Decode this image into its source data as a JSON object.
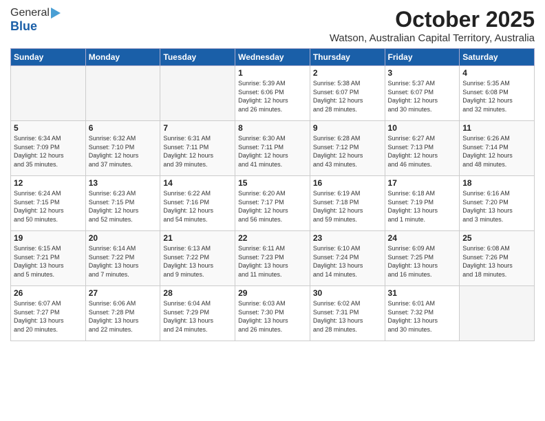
{
  "header": {
    "logo_general": "General",
    "logo_blue": "Blue",
    "month": "October 2025",
    "location": "Watson, Australian Capital Territory, Australia"
  },
  "weekdays": [
    "Sunday",
    "Monday",
    "Tuesday",
    "Wednesday",
    "Thursday",
    "Friday",
    "Saturday"
  ],
  "weeks": [
    [
      {
        "day": "",
        "info": ""
      },
      {
        "day": "",
        "info": ""
      },
      {
        "day": "",
        "info": ""
      },
      {
        "day": "1",
        "info": "Sunrise: 5:39 AM\nSunset: 6:06 PM\nDaylight: 12 hours\nand 26 minutes."
      },
      {
        "day": "2",
        "info": "Sunrise: 5:38 AM\nSunset: 6:07 PM\nDaylight: 12 hours\nand 28 minutes."
      },
      {
        "day": "3",
        "info": "Sunrise: 5:37 AM\nSunset: 6:07 PM\nDaylight: 12 hours\nand 30 minutes."
      },
      {
        "day": "4",
        "info": "Sunrise: 5:35 AM\nSunset: 6:08 PM\nDaylight: 12 hours\nand 32 minutes."
      }
    ],
    [
      {
        "day": "5",
        "info": "Sunrise: 6:34 AM\nSunset: 7:09 PM\nDaylight: 12 hours\nand 35 minutes."
      },
      {
        "day": "6",
        "info": "Sunrise: 6:32 AM\nSunset: 7:10 PM\nDaylight: 12 hours\nand 37 minutes."
      },
      {
        "day": "7",
        "info": "Sunrise: 6:31 AM\nSunset: 7:11 PM\nDaylight: 12 hours\nand 39 minutes."
      },
      {
        "day": "8",
        "info": "Sunrise: 6:30 AM\nSunset: 7:11 PM\nDaylight: 12 hours\nand 41 minutes."
      },
      {
        "day": "9",
        "info": "Sunrise: 6:28 AM\nSunset: 7:12 PM\nDaylight: 12 hours\nand 43 minutes."
      },
      {
        "day": "10",
        "info": "Sunrise: 6:27 AM\nSunset: 7:13 PM\nDaylight: 12 hours\nand 46 minutes."
      },
      {
        "day": "11",
        "info": "Sunrise: 6:26 AM\nSunset: 7:14 PM\nDaylight: 12 hours\nand 48 minutes."
      }
    ],
    [
      {
        "day": "12",
        "info": "Sunrise: 6:24 AM\nSunset: 7:15 PM\nDaylight: 12 hours\nand 50 minutes."
      },
      {
        "day": "13",
        "info": "Sunrise: 6:23 AM\nSunset: 7:15 PM\nDaylight: 12 hours\nand 52 minutes."
      },
      {
        "day": "14",
        "info": "Sunrise: 6:22 AM\nSunset: 7:16 PM\nDaylight: 12 hours\nand 54 minutes."
      },
      {
        "day": "15",
        "info": "Sunrise: 6:20 AM\nSunset: 7:17 PM\nDaylight: 12 hours\nand 56 minutes."
      },
      {
        "day": "16",
        "info": "Sunrise: 6:19 AM\nSunset: 7:18 PM\nDaylight: 12 hours\nand 59 minutes."
      },
      {
        "day": "17",
        "info": "Sunrise: 6:18 AM\nSunset: 7:19 PM\nDaylight: 13 hours\nand 1 minute."
      },
      {
        "day": "18",
        "info": "Sunrise: 6:16 AM\nSunset: 7:20 PM\nDaylight: 13 hours\nand 3 minutes."
      }
    ],
    [
      {
        "day": "19",
        "info": "Sunrise: 6:15 AM\nSunset: 7:21 PM\nDaylight: 13 hours\nand 5 minutes."
      },
      {
        "day": "20",
        "info": "Sunrise: 6:14 AM\nSunset: 7:22 PM\nDaylight: 13 hours\nand 7 minutes."
      },
      {
        "day": "21",
        "info": "Sunrise: 6:13 AM\nSunset: 7:22 PM\nDaylight: 13 hours\nand 9 minutes."
      },
      {
        "day": "22",
        "info": "Sunrise: 6:11 AM\nSunset: 7:23 PM\nDaylight: 13 hours\nand 11 minutes."
      },
      {
        "day": "23",
        "info": "Sunrise: 6:10 AM\nSunset: 7:24 PM\nDaylight: 13 hours\nand 14 minutes."
      },
      {
        "day": "24",
        "info": "Sunrise: 6:09 AM\nSunset: 7:25 PM\nDaylight: 13 hours\nand 16 minutes."
      },
      {
        "day": "25",
        "info": "Sunrise: 6:08 AM\nSunset: 7:26 PM\nDaylight: 13 hours\nand 18 minutes."
      }
    ],
    [
      {
        "day": "26",
        "info": "Sunrise: 6:07 AM\nSunset: 7:27 PM\nDaylight: 13 hours\nand 20 minutes."
      },
      {
        "day": "27",
        "info": "Sunrise: 6:06 AM\nSunset: 7:28 PM\nDaylight: 13 hours\nand 22 minutes."
      },
      {
        "day": "28",
        "info": "Sunrise: 6:04 AM\nSunset: 7:29 PM\nDaylight: 13 hours\nand 24 minutes."
      },
      {
        "day": "29",
        "info": "Sunrise: 6:03 AM\nSunset: 7:30 PM\nDaylight: 13 hours\nand 26 minutes."
      },
      {
        "day": "30",
        "info": "Sunrise: 6:02 AM\nSunset: 7:31 PM\nDaylight: 13 hours\nand 28 minutes."
      },
      {
        "day": "31",
        "info": "Sunrise: 6:01 AM\nSunset: 7:32 PM\nDaylight: 13 hours\nand 30 minutes."
      },
      {
        "day": "",
        "info": ""
      }
    ]
  ]
}
